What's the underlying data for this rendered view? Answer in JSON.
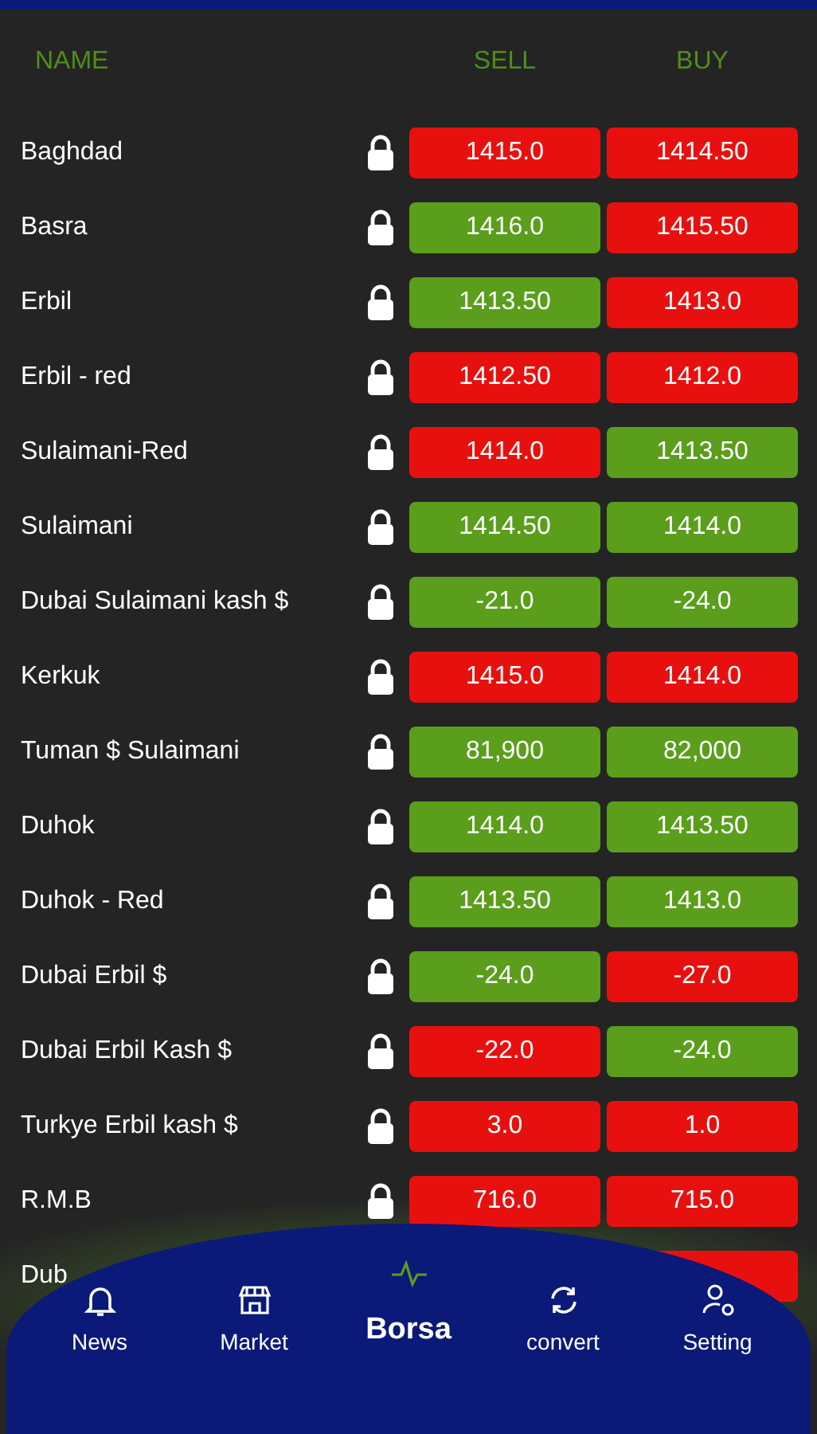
{
  "header": {
    "name": "NAME",
    "sell": "SELL",
    "buy": "BUY"
  },
  "rows": [
    {
      "name": "Baghdad",
      "sell": {
        "value": "1415.0",
        "color": "#e8100f"
      },
      "buy": {
        "value": "1414.50",
        "color": "#e8100f"
      }
    },
    {
      "name": "Basra",
      "sell": {
        "value": "1416.0",
        "color": "#5a9e1c"
      },
      "buy": {
        "value": "1415.50",
        "color": "#e8100f"
      }
    },
    {
      "name": "Erbil",
      "sell": {
        "value": "1413.50",
        "color": "#5a9e1c"
      },
      "buy": {
        "value": "1413.0",
        "color": "#e8100f"
      }
    },
    {
      "name": "Erbil - red",
      "sell": {
        "value": "1412.50",
        "color": "#e8100f"
      },
      "buy": {
        "value": "1412.0",
        "color": "#e8100f"
      }
    },
    {
      "name": "Sulaimani-Red",
      "sell": {
        "value": "1414.0",
        "color": "#e8100f"
      },
      "buy": {
        "value": "1413.50",
        "color": "#5a9e1c"
      }
    },
    {
      "name": "Sulaimani",
      "sell": {
        "value": "1414.50",
        "color": "#5a9e1c"
      },
      "buy": {
        "value": "1414.0",
        "color": "#5a9e1c"
      }
    },
    {
      "name": "Dubai Sulaimani kash $",
      "sell": {
        "value": "-21.0",
        "color": "#5a9e1c"
      },
      "buy": {
        "value": "-24.0",
        "color": "#5a9e1c"
      }
    },
    {
      "name": "Kerkuk",
      "sell": {
        "value": "1415.0",
        "color": "#e8100f"
      },
      "buy": {
        "value": "1414.0",
        "color": "#e8100f"
      }
    },
    {
      "name": "Tuman $ Sulaimani",
      "sell": {
        "value": "81,900",
        "color": "#5a9e1c"
      },
      "buy": {
        "value": "82,000",
        "color": "#5a9e1c"
      }
    },
    {
      "name": "Duhok",
      "sell": {
        "value": "1414.0",
        "color": "#5a9e1c"
      },
      "buy": {
        "value": "1413.50",
        "color": "#5a9e1c"
      }
    },
    {
      "name": "Duhok - Red",
      "sell": {
        "value": "1413.50",
        "color": "#5a9e1c"
      },
      "buy": {
        "value": "1413.0",
        "color": "#5a9e1c"
      }
    },
    {
      "name": "Dubai Erbil $",
      "sell": {
        "value": "-24.0",
        "color": "#5a9e1c"
      },
      "buy": {
        "value": "-27.0",
        "color": "#e8100f"
      }
    },
    {
      "name": "Dubai Erbil Kash $",
      "sell": {
        "value": "-22.0",
        "color": "#e8100f"
      },
      "buy": {
        "value": "-24.0",
        "color": "#5a9e1c"
      }
    },
    {
      "name": "Turkye Erbil kash $",
      "sell": {
        "value": "3.0",
        "color": "#e8100f"
      },
      "buy": {
        "value": "1.0",
        "color": "#e8100f"
      }
    },
    {
      "name": "R.M.B",
      "sell": {
        "value": "716.0",
        "color": "#e8100f"
      },
      "buy": {
        "value": "715.0",
        "color": "#e8100f"
      }
    },
    {
      "name": "Dub",
      "buy": {
        "color": "#e8100f"
      }
    }
  ],
  "nav": [
    {
      "label": "News",
      "kind": "bell",
      "selected": false
    },
    {
      "label": "Market",
      "kind": "store",
      "selected": false
    },
    {
      "label": "Borsa",
      "kind": "pulse",
      "selected": true
    },
    {
      "label": "convert",
      "kind": "sync",
      "selected": false
    },
    {
      "label": "Setting",
      "kind": "user-gear",
      "selected": false
    }
  ]
}
